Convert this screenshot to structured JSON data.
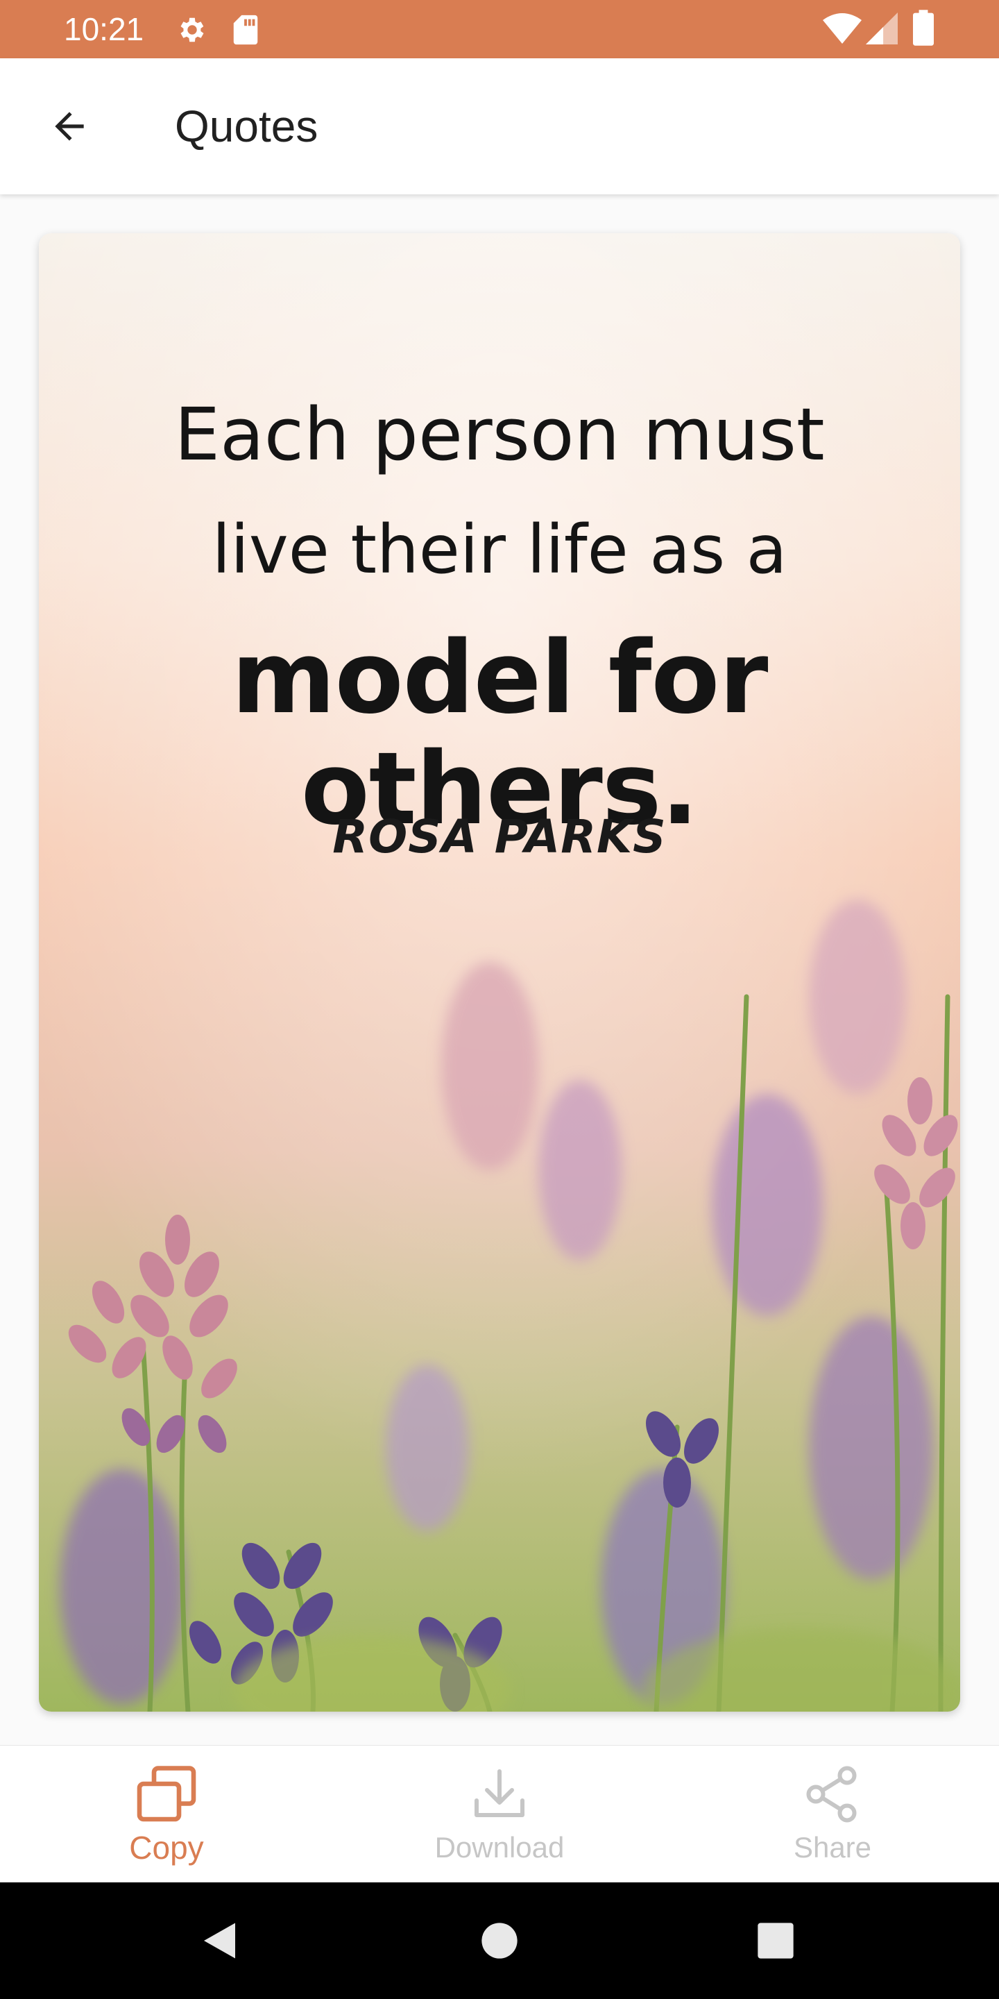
{
  "status_bar": {
    "time": "10:21",
    "icons": [
      "gear-icon",
      "sd-card-icon",
      "wifi-icon",
      "signal-icon",
      "battery-icon"
    ],
    "background": "#d97d52"
  },
  "app_bar": {
    "title": "Quotes",
    "back_icon": "arrow-back-icon"
  },
  "quote": {
    "line1": "Each person must",
    "line2": "live their life as a",
    "line3": "model for others.",
    "author": "ROSA PARKS",
    "background": "lavender-field-photo"
  },
  "actions": [
    {
      "label": "Copy",
      "icon": "copy-icon",
      "active": true
    },
    {
      "label": "Download",
      "icon": "download-icon",
      "active": false
    },
    {
      "label": "Share",
      "icon": "share-icon",
      "active": false
    }
  ],
  "colors": {
    "accent": "#d97d52",
    "inactive": "#c6c6c6"
  },
  "nav_bar": {
    "buttons": [
      "back-triangle-icon",
      "home-circle-icon",
      "recents-square-icon"
    ]
  }
}
